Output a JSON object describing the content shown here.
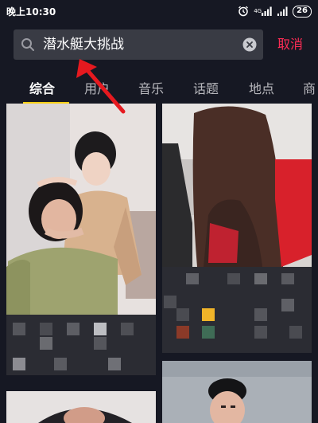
{
  "status_bar": {
    "time": "晚上10:30",
    "network_label": "4G",
    "battery": "26",
    "icons": [
      "alarm-icon",
      "signal-icon",
      "wifi-icon",
      "battery-icon"
    ]
  },
  "search": {
    "query": "潜水艇大挑战",
    "cancel_label": "取消"
  },
  "tabs": [
    {
      "label": "综合",
      "active": true
    },
    {
      "label": "用户",
      "active": false
    },
    {
      "label": "音乐",
      "active": false
    },
    {
      "label": "话题",
      "active": false
    },
    {
      "label": "地点",
      "active": false
    },
    {
      "label": "商",
      "active": false
    }
  ],
  "colors": {
    "background": "#161823",
    "search_bg": "#393b44",
    "accent_red": "#fe2c55",
    "tab_indicator": "#face15",
    "inactive_tab": "#b8b8bd"
  },
  "feed": {
    "cards": [
      {
        "description": "photo of two women posing"
      },
      {
        "description": "photo of long-haired person from behind"
      },
      {
        "description": "photo of person wearing cap"
      },
      {
        "description": "photo of young man"
      }
    ]
  }
}
